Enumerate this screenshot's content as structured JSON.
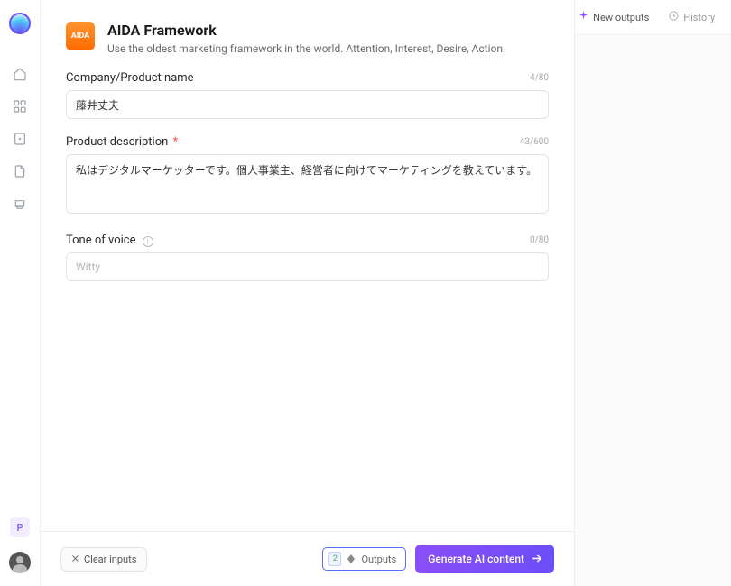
{
  "header": {
    "title": "AIDA Framework",
    "subtitle": "Use the oldest marketing framework in the world. Attention, Interest, Desire, Action.",
    "icon_text": "AIDA"
  },
  "form": {
    "company": {
      "label": "Company/Product name",
      "value": "藤井丈夫",
      "counter": "4/80"
    },
    "description": {
      "label": "Product description",
      "value": "私はデジタルマーケッターです。個人事業主、経営者に向けてマーケティングを教えています。",
      "counter": "43/600"
    },
    "tone": {
      "label": "Tone of voice",
      "placeholder": "Witty",
      "value": "",
      "counter": "0/80"
    }
  },
  "footer": {
    "clear_label": "Clear inputs",
    "outputs_label": "Outputs",
    "outputs_value": "2",
    "generate_label": "Generate AI content"
  },
  "right": {
    "new_outputs": "New outputs",
    "history": "History"
  },
  "sidebar": {
    "badge": "P"
  }
}
